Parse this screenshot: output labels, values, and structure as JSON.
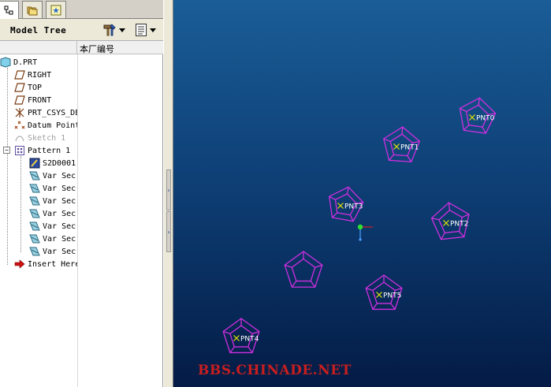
{
  "panel": {
    "title": "Model Tree",
    "column_header": "本厂编号"
  },
  "tree": [
    {
      "label": "D.PRT",
      "icon": "part-icon",
      "level": 0,
      "dim": false
    },
    {
      "label": "RIGHT",
      "icon": "datum-plane-icon",
      "level": 1,
      "dim": false
    },
    {
      "label": "TOP",
      "icon": "datum-plane-icon",
      "level": 1,
      "dim": false
    },
    {
      "label": "FRONT",
      "icon": "datum-plane-icon",
      "level": 1,
      "dim": false
    },
    {
      "label": "PRT_CSYS_DEF",
      "icon": "csys-icon",
      "level": 1,
      "dim": false
    },
    {
      "label": "Datum Point",
      "icon": "datum-point-icon",
      "level": 1,
      "dim": false
    },
    {
      "label": "Sketch 1",
      "icon": "sketch-icon",
      "level": 1,
      "dim": true
    },
    {
      "label": "Pattern 1",
      "icon": "pattern-icon",
      "level": 1,
      "dim": false
    },
    {
      "label": "S2D0001",
      "icon": "sketch-edit-icon",
      "level": 2,
      "dim": false
    },
    {
      "label": "Var Sec",
      "icon": "var-sec-icon",
      "level": 2,
      "dim": false
    },
    {
      "label": "Var Sec",
      "icon": "var-sec-icon",
      "level": 2,
      "dim": false
    },
    {
      "label": "Var Sec",
      "icon": "var-sec-icon",
      "level": 2,
      "dim": false
    },
    {
      "label": "Var Sec",
      "icon": "var-sec-icon",
      "level": 2,
      "dim": false
    },
    {
      "label": "Var Sec",
      "icon": "var-sec-icon",
      "level": 2,
      "dim": false
    },
    {
      "label": "Var Sec",
      "icon": "var-sec-icon",
      "level": 2,
      "dim": false
    },
    {
      "label": "Var Sec",
      "icon": "var-sec-icon",
      "level": 2,
      "dim": false
    },
    {
      "label": "Insert Here",
      "icon": "insert-arrow-icon",
      "level": 1,
      "dim": false
    }
  ],
  "viewport": {
    "points": [
      "PNT0",
      "PNT1",
      "PNT2",
      "PNT3",
      "PNT4",
      "PNT5"
    ],
    "watermark": "BBS.CHINADE.NET",
    "colors": {
      "pentagon": "#d02ee0",
      "point_marker": "#e6e600",
      "label": "#ffffff"
    }
  }
}
